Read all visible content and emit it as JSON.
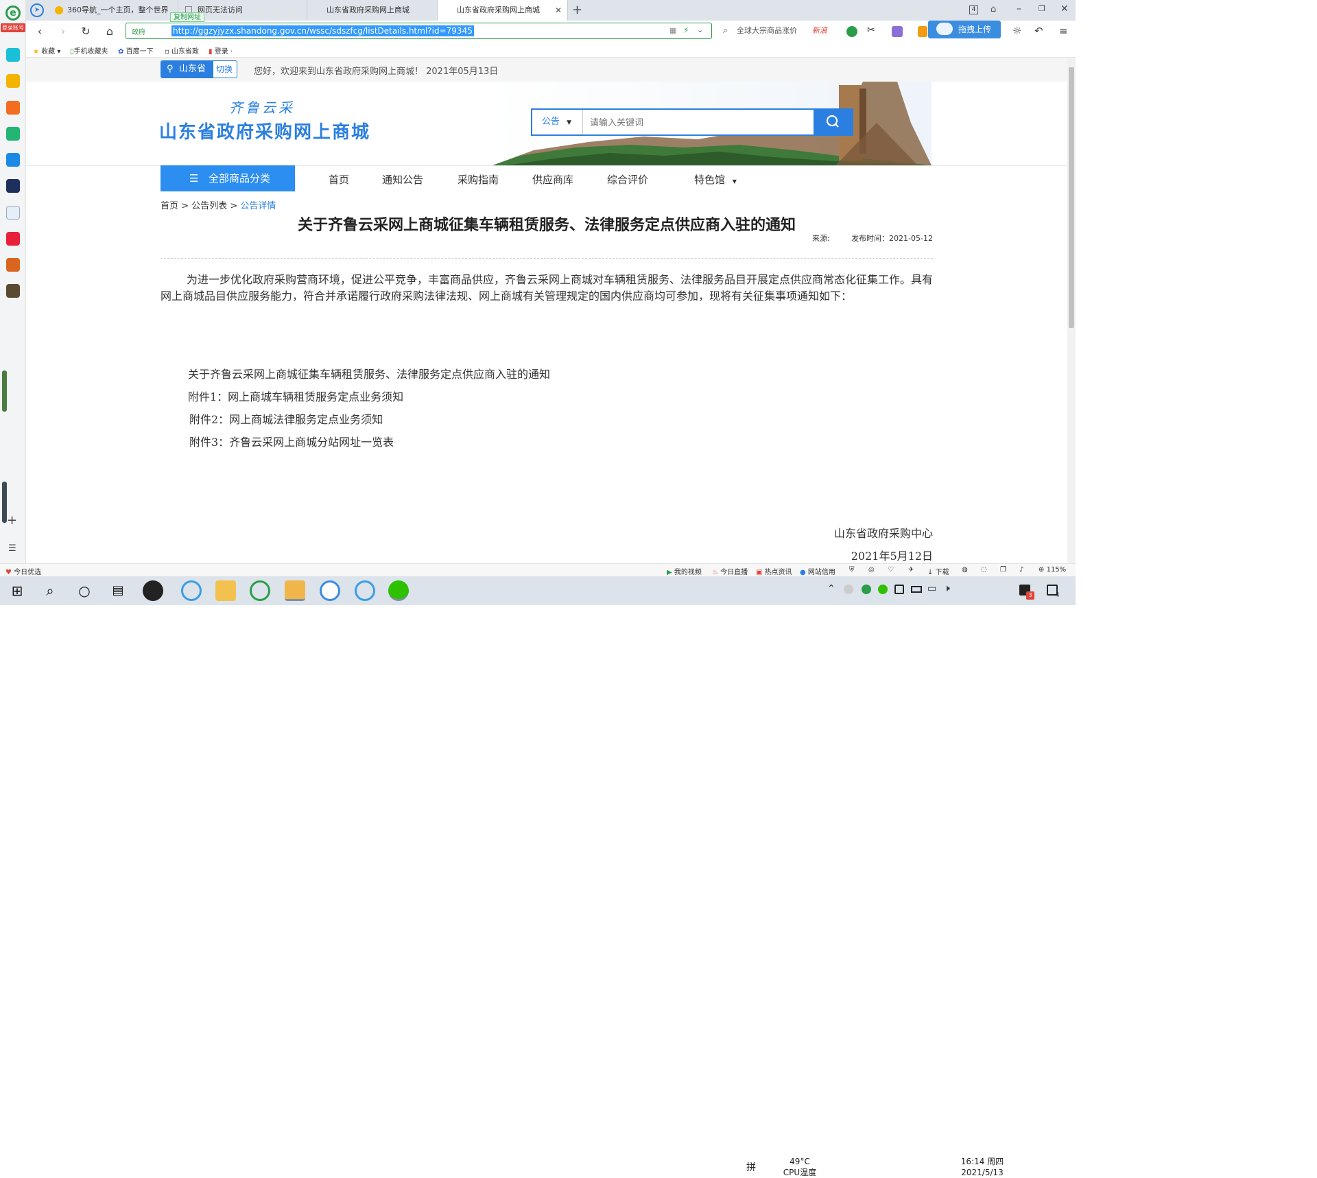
{
  "tabs": [
    {
      "label": "360导航_一个主页，整个世界"
    },
    {
      "label": "网页无法访问"
    },
    {
      "label": "山东省政府采购网上商城"
    },
    {
      "label": "山东省政府采购网上商城"
    }
  ],
  "tab_count": "4",
  "address": {
    "badge": "政府",
    "url": "http://ggzyjyzx.shandong.gov.cn/wssc/sdszfcg/listDetails.html?id=79345",
    "copy_label": "复制网址"
  },
  "side_search": {
    "text": "全球大宗商品涨价",
    "hot": "新浪"
  },
  "upload_label": "拖拽上传",
  "bookmarks": [
    "收藏",
    "手机收藏夹",
    "百度一下",
    "山东省政",
    "登录"
  ],
  "login_badge": "登录账号",
  "site": {
    "region": "山东省",
    "switch": "切换",
    "welcome": "您好，欢迎来到山东省政府采购网上商城！ 2021年05月13日",
    "logo_sub": "齐鲁云采",
    "logo_main": "山东省政府采购网上商城",
    "search_category": "公告",
    "search_placeholder": "请输入关键词",
    "category_button": "全部商品分类",
    "nav": [
      "首页",
      "通知公告",
      "采购指南",
      "供应商库",
      "综合评价",
      "特色馆"
    ],
    "breadcrumb": {
      "home": "首页",
      "list": "公告列表",
      "current": "公告详情",
      "sep": ">"
    }
  },
  "article": {
    "title": "关于齐鲁云采网上商城征集车辆租赁服务、法律服务定点供应商入驻的通知",
    "source_label": "来源:",
    "date_label": "发布时间：2021-05-12",
    "paragraph": "为进一步优化政府采购营商环境，促进公平竞争，丰富商品供应，齐鲁云采网上商城对车辆租赁服务、法律服务品目开展定点供应商常态化征集工作。具有网上商城品目供应服务能力，符合并承诺履行政府采购法律法规、网上商城有关管理规定的国内供应商均可参加，现将有关征集事项通知如下：",
    "attachments": [
      "关于齐鲁云采网上商城征集车辆租赁服务、法律服务定点供应商入驻的通知",
      "附件1：网上商城车辆租赁服务定点业务须知",
      "附件2：网上商城法律服务定点业务须知",
      "附件3：齐鲁云采网上商城分站网址一览表"
    ],
    "signature": "山东省政府采购中心",
    "sign_date": "2021年5月12日"
  },
  "statusbar": {
    "left": "今日优选",
    "items": [
      "我的视频",
      "今日直播",
      "热点资讯",
      "网站信用",
      "下载"
    ],
    "zoom": "115%"
  },
  "taskbar": {
    "ime": "拼",
    "temp": "49°C",
    "temp_label": "CPU温度",
    "time": "16:14 周四",
    "date": "2021/5/13",
    "notif_count": "3",
    "action_count": "4"
  },
  "colors": {
    "brand": "#2b7fe0",
    "accent_green": "#2a9d4a"
  }
}
